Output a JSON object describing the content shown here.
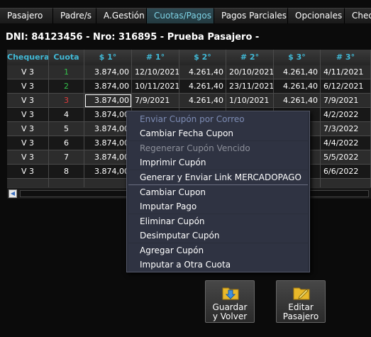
{
  "tabs": [
    {
      "label": "Pasajero",
      "active": false
    },
    {
      "label": "Padre/s",
      "active": false
    },
    {
      "label": "A.Gestión",
      "active": false
    },
    {
      "label": "Cuotas/Pagos",
      "active": true
    },
    {
      "label": "Pagos Parciales",
      "active": false
    },
    {
      "label": "Opcionales",
      "active": false
    },
    {
      "label": "Cheq",
      "active": false
    }
  ],
  "title": "DNI: 84123456 - Nro: 316895 - Prueba Pasajero -",
  "grid": {
    "columns": [
      "Chequera",
      "Cuota",
      "$ 1°",
      "# 1°",
      "$ 2°",
      "# 2°",
      "$ 3°",
      "# 3°"
    ],
    "rows": [
      {
        "chequera": "V 3",
        "cuota": "1",
        "cuota_color": "green",
        "p1": "3.874,00",
        "f1": "12/10/2021",
        "p2": "4.261,40",
        "f2": "20/10/2021",
        "p3": "4.261,40",
        "f3": "4/11/2021"
      },
      {
        "chequera": "V 3",
        "cuota": "2",
        "cuota_color": "green",
        "p1": "3.874,00",
        "f1": "10/11/2021",
        "p2": "4.261,40",
        "f2": "23/11/2021",
        "p3": "4.261,40",
        "f3": "6/12/2021"
      },
      {
        "chequera": "V 3",
        "cuota": "3",
        "cuota_color": "red",
        "p1": "3.874,00",
        "f1": "7/9/2021",
        "p2": "4.261,40",
        "f2": "1/10/2021",
        "p3": "4.261,40",
        "f3": "7/9/2021"
      },
      {
        "chequera": "V 3",
        "cuota": "4",
        "cuota_color": "white",
        "p1": "3.874,00",
        "f1": "",
        "p2": "",
        "f2": "",
        "p3": "",
        "f3": "4/2/2022"
      },
      {
        "chequera": "V 3",
        "cuota": "5",
        "cuota_color": "white",
        "p1": "3.874,00",
        "f1": "",
        "p2": "",
        "f2": "",
        "p3": "",
        "f3": "7/3/2022"
      },
      {
        "chequera": "V 3",
        "cuota": "6",
        "cuota_color": "white",
        "p1": "3.874,00",
        "f1": "",
        "p2": "",
        "f2": "",
        "p3": "",
        "f3": "4/4/2022"
      },
      {
        "chequera": "V 3",
        "cuota": "7",
        "cuota_color": "white",
        "p1": "3.874,00",
        "f1": "",
        "p2": "",
        "f2": "",
        "p3": "",
        "f3": "5/5/2022"
      },
      {
        "chequera": "V 3",
        "cuota": "8",
        "cuota_color": "white",
        "p1": "3.874,00",
        "f1": "",
        "p2": "",
        "f2": "",
        "p3": "",
        "f3": "6/6/2022"
      }
    ],
    "row_colors": {
      "header_text": "#41b9d6",
      "row_dark": "#181818",
      "row_light": "#2c2c2c"
    }
  },
  "context_menu": {
    "items": [
      {
        "label": "Enviar Cupón por Correo",
        "enabled": true,
        "style": "first"
      },
      {
        "label": "Cambiar Fecha Cupon",
        "enabled": true
      },
      {
        "label": "Regenerar Cupón Vencido",
        "enabled": false
      },
      {
        "label": "Imprimir Cupón",
        "enabled": true
      },
      {
        "label": "Generar y Enviar Link MERCADOPAGO",
        "enabled": true
      },
      {
        "label": "Cambiar Cupon",
        "enabled": true
      },
      {
        "label": "Imputar Pago",
        "enabled": true
      },
      {
        "label": "Eliminar Cupón",
        "enabled": true
      },
      {
        "label": "Desimputar Cupón",
        "enabled": true
      },
      {
        "label": "Agregar Cupón",
        "enabled": true
      },
      {
        "label": "Imputar a Otra Cuota",
        "enabled": true
      }
    ]
  },
  "buttons": {
    "save": {
      "line1": "Guardar",
      "line2": "y Volver",
      "icon": "folder-download-icon"
    },
    "edit": {
      "line1": "Editar",
      "line2": "Pasajero",
      "icon": "folder-edit-icon"
    }
  }
}
